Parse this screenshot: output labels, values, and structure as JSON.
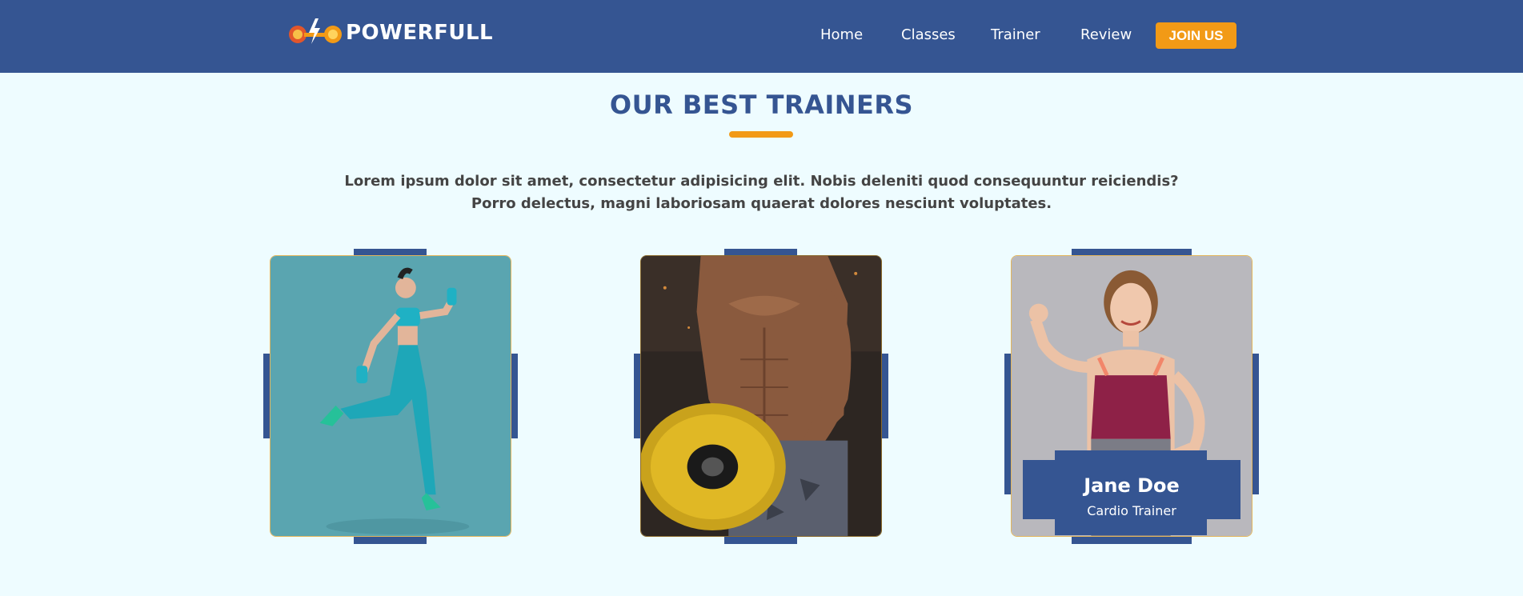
{
  "brand": {
    "name": "POWERFULL"
  },
  "nav": {
    "links": [
      {
        "label": "Home"
      },
      {
        "label": "Classes"
      },
      {
        "label": "Trainer"
      },
      {
        "label": "Review"
      }
    ],
    "cta_label": "JOIN US"
  },
  "section": {
    "title": "OUR BEST TRAINERS",
    "description": "Lorem ipsum dolor sit amet, consectetur adipisicing elit. Nobis deleniti quod consequuntur reiciendis? Porro delectus, magni laboriosam quaerat dolores nesciunt voluptates."
  },
  "trainers": [
    {
      "photo": "woman-running-with-dumbbells"
    },
    {
      "photo": "muscular-man-holding-weight-plate"
    },
    {
      "photo": "smiling-woman-ok-gesture",
      "name": "Jane Doe",
      "role": "Cardio Trainer"
    }
  ],
  "colors": {
    "nav_background": "#355592",
    "accent": "#f29a16",
    "page_background": "#eefcff",
    "card_border": "#e3b55b"
  }
}
